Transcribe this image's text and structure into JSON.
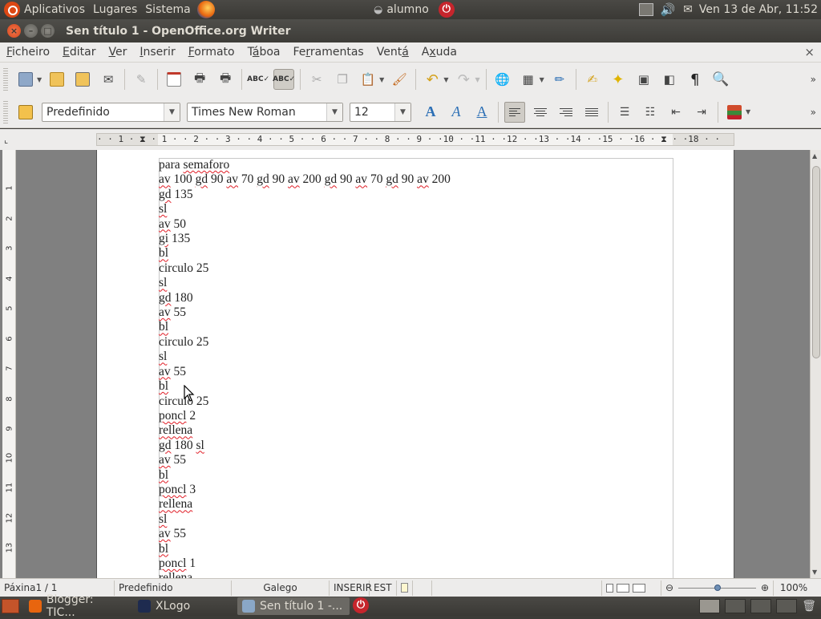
{
  "top_panel": {
    "menus": [
      "Aplicativos",
      "Lugares",
      "Sistema"
    ],
    "user": "alumno",
    "clock": "Ven 13 de Abr, 11:52"
  },
  "window": {
    "title": "Sen título 1 - OpenOffice.org Writer"
  },
  "menubar": {
    "items": [
      {
        "accel": "F",
        "rest": "icheiro"
      },
      {
        "accel": "E",
        "rest": "ditar"
      },
      {
        "accel": "V",
        "rest": "er"
      },
      {
        "accel": "I",
        "rest": "nserir"
      },
      {
        "accel": "F",
        "rest": "ormato"
      },
      {
        "pre": "T",
        "accel": "á",
        "rest": "boa"
      },
      {
        "pre": "Fe",
        "accel": "r",
        "rest": "ramentas"
      },
      {
        "pre": "Vent",
        "accel": "á",
        "rest": ""
      },
      {
        "pre": "A",
        "accel": "x",
        "rest": "uda"
      }
    ],
    "close_glyph": "×"
  },
  "format_toolbar": {
    "style": "Predefinido",
    "font": "Times New Roman",
    "size": "12"
  },
  "ruler": {
    "text": "· · 1 · ⧗ · 1 · · 2 · · 3 · · 4 · · 5 · · 6 · · 7 · · 8 · · 9 · ·10 · ·11 · ·12 · ·13 · ·14 · ·15 · ·16 · ⧗ · ·18 · ·",
    "vertical_numbers": [
      "1",
      "2",
      "3",
      "4",
      "5",
      "6",
      "7",
      "8",
      "9",
      "10",
      "11",
      "12",
      "13"
    ]
  },
  "document": {
    "lines": [
      [
        {
          "t": "para "
        },
        {
          "t": "semaforo",
          "err": true
        }
      ],
      [
        {
          "t": "av",
          "err": true
        },
        {
          "t": " 100 "
        },
        {
          "t": "gd",
          "err": true
        },
        {
          "t": " 90 "
        },
        {
          "t": "av",
          "err": true
        },
        {
          "t": " 70 "
        },
        {
          "t": "gd",
          "err": true
        },
        {
          "t": " 90 "
        },
        {
          "t": "av",
          "err": true
        },
        {
          "t": " 200 "
        },
        {
          "t": "gd",
          "err": true
        },
        {
          "t": " 90 "
        },
        {
          "t": "av",
          "err": true
        },
        {
          "t": " 70 "
        },
        {
          "t": "gd",
          "err": true
        },
        {
          "t": " 90 "
        },
        {
          "t": "av",
          "err": true
        },
        {
          "t": " 200"
        }
      ],
      [
        {
          "t": "gd",
          "err": true
        },
        {
          "t": " 135"
        }
      ],
      [
        {
          "t": "sl",
          "err": true
        }
      ],
      [
        {
          "t": "av",
          "err": true
        },
        {
          "t": " 50"
        }
      ],
      [
        {
          "t": "gi",
          "err": true
        },
        {
          "t": " 135"
        }
      ],
      [
        {
          "t": "bl",
          "err": true
        }
      ],
      [
        {
          "t": "circulo 25"
        }
      ],
      [
        {
          "t": "sl",
          "err": true
        }
      ],
      [
        {
          "t": "gd",
          "err": true
        },
        {
          "t": " 180"
        }
      ],
      [
        {
          "t": "av",
          "err": true
        },
        {
          "t": " 55"
        }
      ],
      [
        {
          "t": "bl",
          "err": true
        }
      ],
      [
        {
          "t": "circulo 25"
        }
      ],
      [
        {
          "t": "sl",
          "err": true
        }
      ],
      [
        {
          "t": "av",
          "err": true
        },
        {
          "t": " 55"
        }
      ],
      [
        {
          "t": "bl",
          "err": true
        }
      ],
      [
        {
          "t": "circulo 25"
        }
      ],
      [
        {
          "t": "poncl",
          "err": true
        },
        {
          "t": " 2"
        }
      ],
      [
        {
          "t": "rellena",
          "err": true
        }
      ],
      [
        {
          "t": "gd",
          "err": true
        },
        {
          "t": " 180 "
        },
        {
          "t": "sl",
          "err": true
        }
      ],
      [
        {
          "t": "av",
          "err": true
        },
        {
          "t": " 55"
        }
      ],
      [
        {
          "t": "bl",
          "err": true
        }
      ],
      [
        {
          "t": "poncl",
          "err": true
        },
        {
          "t": " 3"
        }
      ],
      [
        {
          "t": "rellena",
          "err": true
        }
      ],
      [
        {
          "t": "sl",
          "err": true
        }
      ],
      [
        {
          "t": "av",
          "err": true
        },
        {
          "t": " 55"
        }
      ],
      [
        {
          "t": "bl",
          "err": true
        }
      ],
      [
        {
          "t": "poncl",
          "err": true
        },
        {
          "t": " 1"
        }
      ],
      [
        {
          "t": "rellena",
          "err": true
        }
      ]
    ]
  },
  "statusbar": {
    "page": "Páxina1 / 1",
    "style": "Predefinido",
    "language": "Galego",
    "insert_mode": "INSERIR",
    "selection_mode": "EST",
    "zoom": "100%"
  },
  "taskbar": {
    "tasks": [
      {
        "label": "Blogger: TIC...",
        "icon": "firefox-icon",
        "color": "#e8650e"
      },
      {
        "label": "XLogo",
        "icon": "xlogo-icon",
        "color": "#1e2b4f"
      },
      {
        "label": "Sen título 1 -...",
        "icon": "writer-icon",
        "color": "#8aa7c7",
        "active": true
      }
    ]
  },
  "colors": {
    "panel_bg": "#3c3b37",
    "spell_error": "#e01b24",
    "ubuntu_orange": "#dd4814"
  }
}
